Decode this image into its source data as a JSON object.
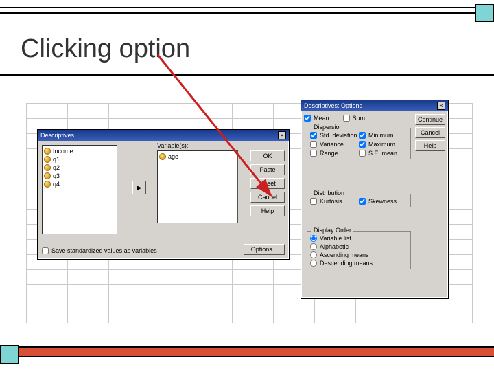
{
  "slide": {
    "title": "Clicking option"
  },
  "dialog1": {
    "title": "Descriptives",
    "close": "×",
    "vars_label": "Variable(s):",
    "source_items": [
      "Income",
      "q1",
      "q2",
      "q3",
      "q4"
    ],
    "target_items": [
      "age"
    ],
    "move_glyph": "▶",
    "buttons": {
      "ok": "OK",
      "paste": "Paste",
      "reset": "Reset",
      "cancel": "Cancel",
      "help": "Help"
    },
    "save_cb": "Save standardized values as variables",
    "options_btn": "Options..."
  },
  "dialog2": {
    "title": "Descriptives: Options",
    "close": "×",
    "top": {
      "mean": "Mean",
      "sum": "Sum"
    },
    "dispersion": {
      "legend": "Dispersion",
      "std": "Std. deviation",
      "min": "Minimum",
      "var": "Variance",
      "max": "Maximum",
      "range": "Range",
      "se": "S.E. mean"
    },
    "distribution": {
      "legend": "Distribution",
      "kurtosis": "Kurtosis",
      "skewness": "Skewness"
    },
    "order": {
      "legend": "Display Order",
      "varlist": "Variable list",
      "alpha": "Alphabetic",
      "asc": "Ascending means",
      "desc": "Descending means"
    },
    "buttons": {
      "continue": "Continue",
      "cancel": "Cancel",
      "help": "Help"
    }
  }
}
